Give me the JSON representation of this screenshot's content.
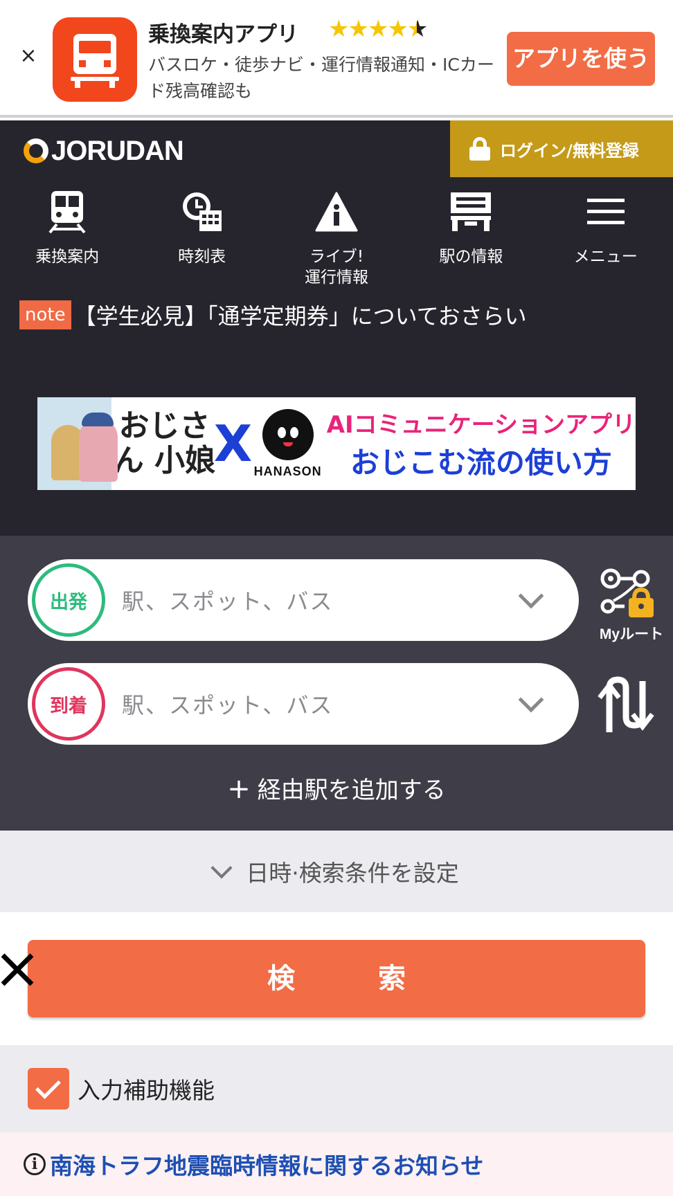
{
  "banner": {
    "app_name": "乗換案内アプリ",
    "rating_full": "★★★★",
    "rating_half": "★",
    "description": "バスロケ・徒歩ナビ・運行情報通知・ICカード残高確認も",
    "use_app": "アプリを使う",
    "close": "×"
  },
  "header": {
    "logo": "JORUDAN",
    "login": "ログイン/無料登録"
  },
  "nav": {
    "items": [
      {
        "label": "乗換案内",
        "icon": "train-icon"
      },
      {
        "label": "時刻表",
        "icon": "timetable-icon"
      },
      {
        "label": "ライブ!\n運行情報",
        "icon": "warning-icon"
      },
      {
        "label": "駅の情報",
        "icon": "station-icon"
      },
      {
        "label": "メニュー",
        "icon": "menu-icon"
      }
    ]
  },
  "note": {
    "badge": "note",
    "text": "【学生必見】「通学定期券」についておさらい"
  },
  "ad": {
    "title": "おじさん 小娘",
    "x": "X",
    "brand": "HANASON",
    "copy1": "AIコミュニケーションアプリ",
    "copy2": "おじこむ流の使い方"
  },
  "search": {
    "from_badge": "出発",
    "to_badge": "到着",
    "placeholder": "駅、スポット、バス",
    "myroute": "Myルート",
    "add_via": "経由駅を追加する",
    "add_via_plus": "+"
  },
  "conditions": {
    "label": "日時·検索条件を設定"
  },
  "search_button": "検　索",
  "assist": {
    "label": "入力補助機能",
    "checked": true
  },
  "notice": {
    "icon": "i",
    "text": "南海トラフ地震臨時情報に関するお知らせ"
  },
  "colors": {
    "accent": "#f26c45",
    "header_bg": "#26252d",
    "panel_bg": "#3f3d47",
    "login_gold": "#c49a18",
    "from_green": "#2cbb7d",
    "to_red": "#e0355d",
    "link_blue": "#1d4fb3"
  }
}
